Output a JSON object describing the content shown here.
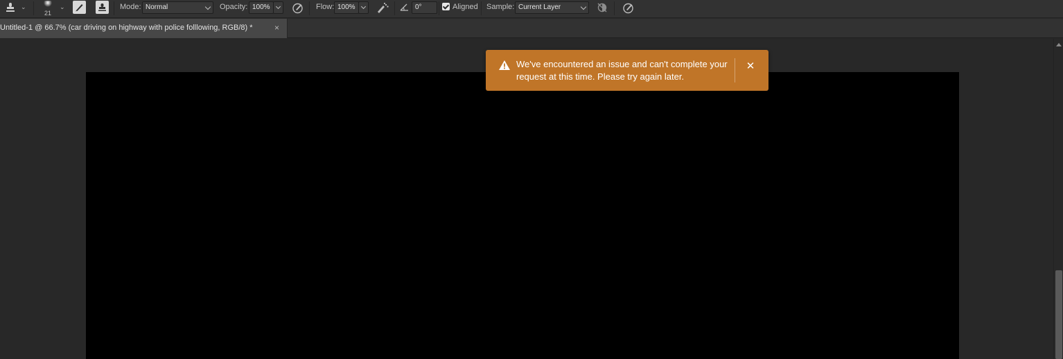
{
  "options_bar": {
    "brush_size": "21",
    "mode_label": "Mode:",
    "mode_value": "Normal",
    "opacity_label": "Opacity:",
    "opacity_value": "100%",
    "flow_label": "Flow:",
    "flow_value": "100%",
    "angle_value": "0°",
    "aligned_label": "Aligned",
    "aligned_checked": true,
    "sample_label": "Sample:",
    "sample_value": "Current Layer",
    "icons": [
      "clone-stamp-icon",
      "brush-preset-icon",
      "toggle-brush-settings-icon",
      "toggle-clone-source-icon",
      "pressure-opacity-icon",
      "airbrush-icon",
      "angle-icon",
      "ignore-adjustment-layers-icon",
      "pressure-size-icon"
    ]
  },
  "document_tab": {
    "title": "Untitled-1 @ 66.7% (car driving on highway with police folllowing, RGB/8) *",
    "close_glyph": "×"
  },
  "toast": {
    "message": "We've encountered an issue and can't complete your request at this time. Please try again later.",
    "close_glyph": "✕",
    "background": "#c07528"
  },
  "colors": {
    "workspace": "#282828",
    "canvas": "#000000",
    "toolbar": "#323232"
  }
}
